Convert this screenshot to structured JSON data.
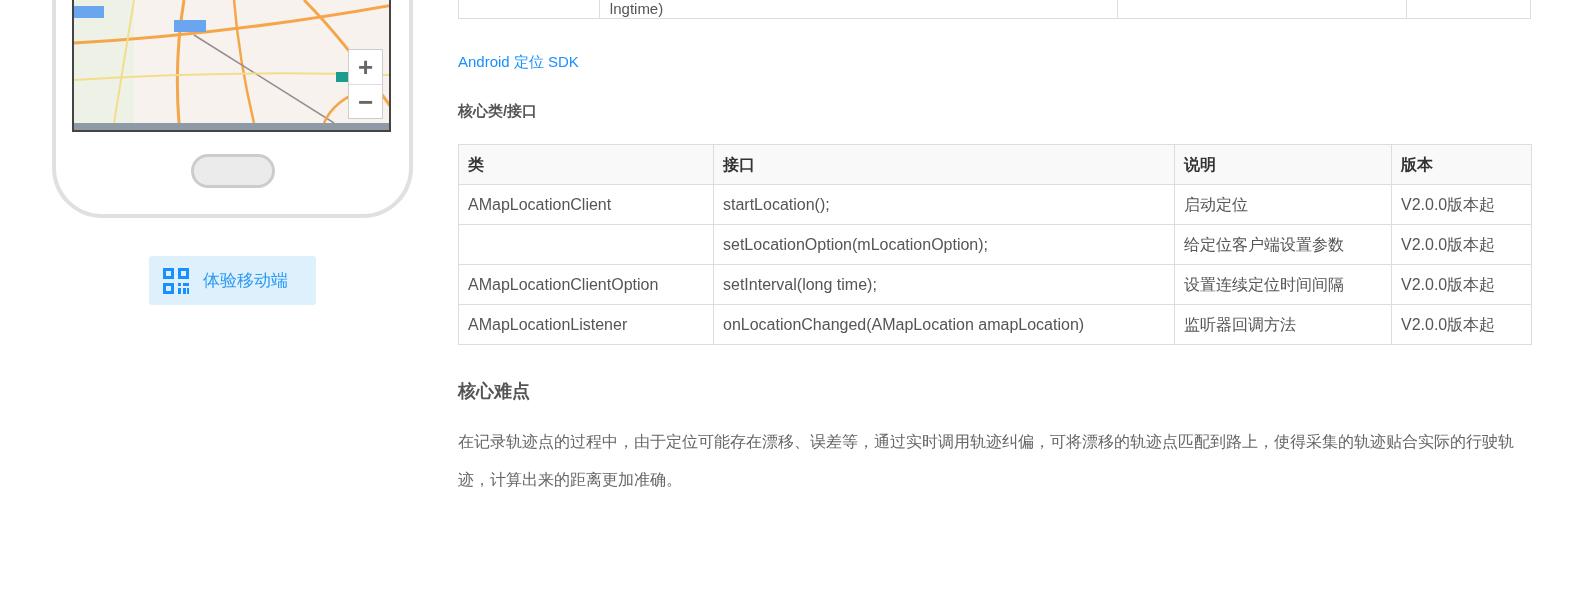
{
  "phone": {
    "zoom_controls": [
      "+",
      "−"
    ]
  },
  "mobile_button": {
    "label": "体验移动端"
  },
  "previous_table": {
    "column_2": "lngtime)"
  },
  "sdk_link": "Android 定位 SDK",
  "section_title": "核心类/接口",
  "api_table": {
    "columns": [
      "类",
      "接口",
      "说明",
      "版本"
    ],
    "rows": [
      [
        "AMapLocationClient",
        "startLocation();",
        "启动定位",
        "V2.0.0版本起"
      ],
      [
        null,
        "setLocationOption(mLocationOption);",
        "给定位客户端设置参数",
        "V2.0.0版本起"
      ],
      [
        "AMapLocationClientOption",
        "setInterval(long time);",
        "设置连续定位时间间隔",
        "V2.0.0版本起"
      ],
      [
        "AMapLocationListener",
        "onLocationChanged(AMapLocation amapLocation)",
        "监听器回调方法",
        "V2.0.0版本起"
      ]
    ]
  },
  "difficulty_title": "核心难点",
  "difficulty_text": "在记录轨迹点的过程中，由于定位可能存在漂移、误差等，通过实时调用轨迹纠偏，可将漂移的轨迹点匹配到路上，使得采集的轨迹贴合实际的行驶轨迹，计算出来的距离更加准确。"
}
